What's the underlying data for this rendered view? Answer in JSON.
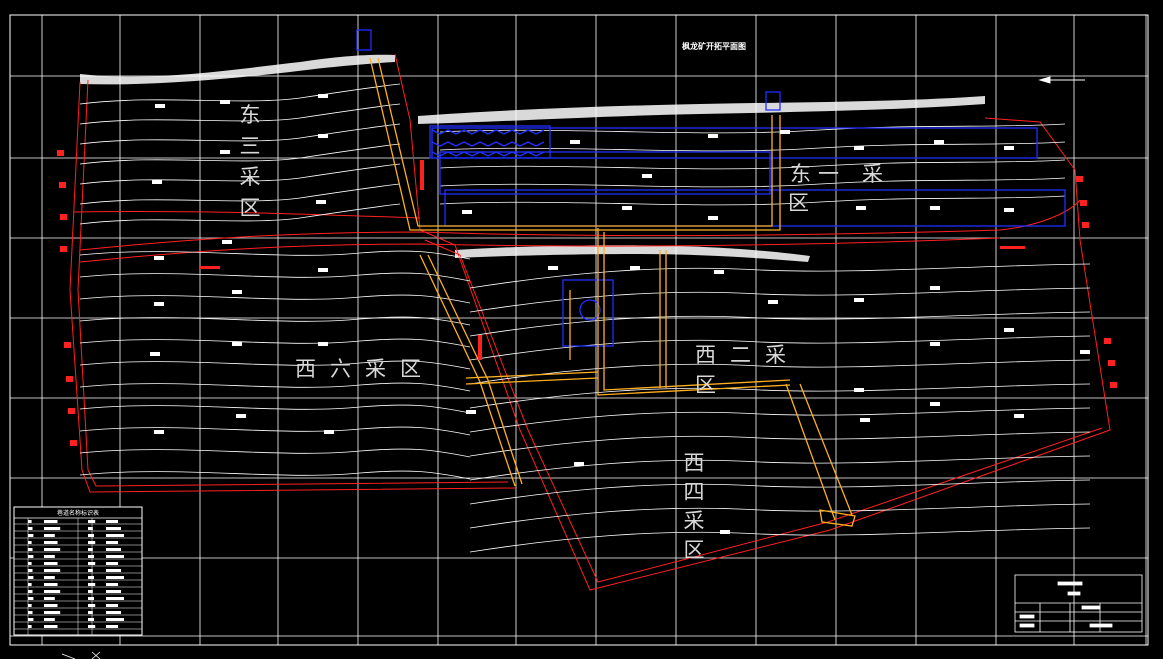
{
  "drawing": {
    "title": "枫龙矿开拓平面图"
  },
  "zones": {
    "east_three": "东三采区",
    "east_one": "东一采区",
    "west_six": "西六采区",
    "west_two": "西二采区",
    "west_four": "西四采区"
  },
  "legend_table": {
    "title": "巷道名称标识表"
  },
  "colors": {
    "background": "#000000",
    "grid": "#ffffff",
    "contour": "#ffffff",
    "boundary": "#ff2020",
    "roadway": "#ffb020",
    "working": "#2030ff"
  }
}
